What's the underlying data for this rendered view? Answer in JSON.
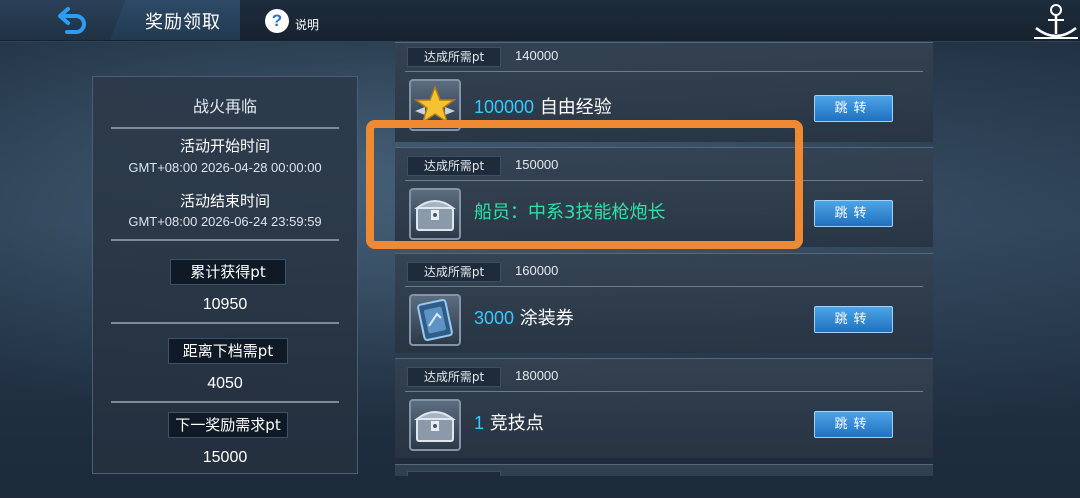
{
  "header": {
    "title": "奖励领取",
    "help_label": "说明"
  },
  "left_panel": {
    "event_name": "战火再临",
    "start_label": "活动开始时间",
    "start_time": "GMT+08:00 2026-04-28 00:00:00",
    "end_label": "活动结束时间",
    "end_time": "GMT+08:00 2026-06-24 23:59:59",
    "accumulated_label": "累计获得pt",
    "accumulated_value": "10950",
    "next_tier_label": "距离下档需pt",
    "next_tier_value": "4050",
    "next_reward_label": "下一奖励需求pt",
    "next_reward_value": "15000"
  },
  "rewards": [
    {
      "req_label": "达成所需pt",
      "req_value": "140000",
      "qty": "100000",
      "name": "自由经验",
      "icon": "gold-star-emblem-icon",
      "button": "跳转"
    },
    {
      "req_label": "达成所需pt",
      "req_value": "150000",
      "qty": "",
      "name": "船员：中系3技能枪炮长",
      "icon": "treasure-chest-icon",
      "button": "跳转",
      "highlighted": true
    },
    {
      "req_label": "达成所需pt",
      "req_value": "160000",
      "qty": "3000",
      "name": "涂装券",
      "icon": "camo-ticket-icon",
      "button": "跳转"
    },
    {
      "req_label": "达成所需pt",
      "req_value": "180000",
      "qty": "1",
      "name": "竞技点",
      "icon": "treasure-chest-icon",
      "button": "跳转"
    }
  ],
  "colors": {
    "accent_blue": "#35c9ff",
    "crew_green": "#2fe0a8",
    "highlight_orange": "#f08a32",
    "button_blue": "#2f87d6"
  }
}
